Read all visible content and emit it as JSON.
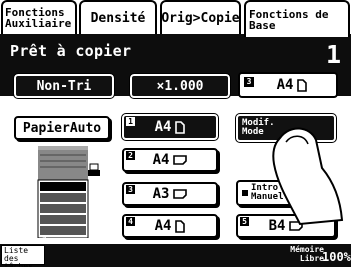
{
  "tabs": [
    {
      "label": "Fonctions Auxiliaire"
    },
    {
      "label": "Densité"
    },
    {
      "label": "Orig>Copie"
    },
    {
      "label": "Fonctions de Base"
    }
  ],
  "status": {
    "message": "Prêt à copier",
    "copies": "1"
  },
  "top_row": {
    "sort": "Non-Tri",
    "zoom": "×1.000",
    "selected_tray_num": "3",
    "selected_paper": "A4"
  },
  "buttons": {
    "paper_auto": "PapierAuto",
    "mode_change": "Modif. Mode",
    "manual_input": "Intro Manuel"
  },
  "trays": [
    {
      "num": "1",
      "size": "A4",
      "orientation": "portrait"
    },
    {
      "num": "2",
      "size": "A4",
      "orientation": "landscape"
    },
    {
      "num": "3",
      "size": "A3",
      "orientation": "landscape"
    },
    {
      "num": "4",
      "size": "A4",
      "orientation": "portrait"
    },
    {
      "num": "5",
      "size": "B4",
      "orientation": "landscape"
    }
  ],
  "machine_tray_labels": [
    "1",
    "2",
    "3",
    "4",
    "5"
  ],
  "bottom": {
    "job_list": "Liste des tâches",
    "memory_label": "Mémoire Libre",
    "memory_value": "100%"
  }
}
